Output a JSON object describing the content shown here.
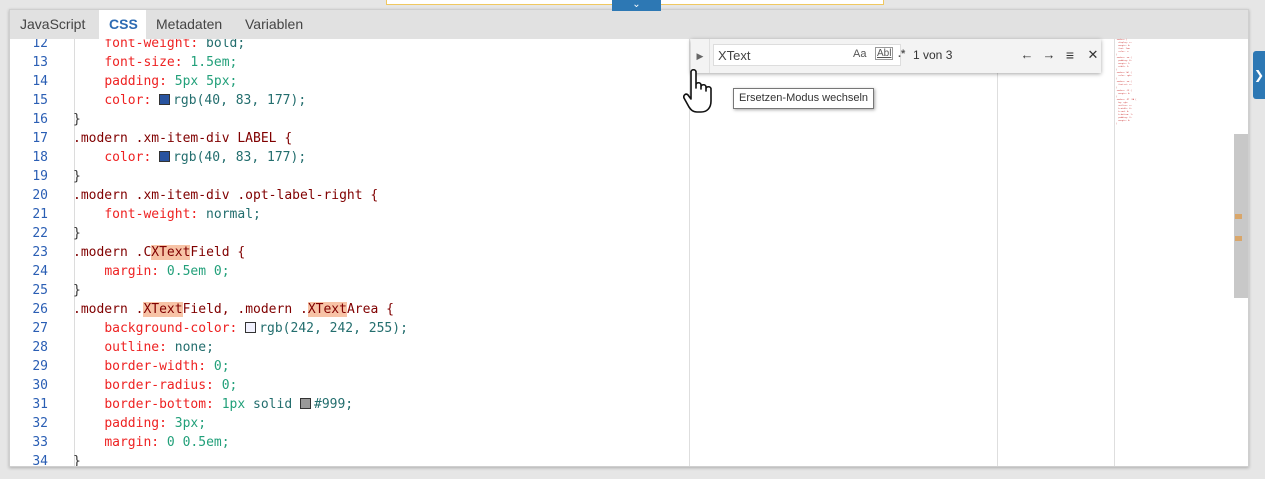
{
  "tabs": [
    {
      "label": "JavaScript",
      "active": false
    },
    {
      "label": "CSS",
      "active": true
    },
    {
      "label": "Metadaten",
      "active": false
    },
    {
      "label": "Variablen",
      "active": false
    }
  ],
  "find": {
    "query": "XText",
    "match_case": "Aa",
    "whole_word": "Abl",
    "regex": ".*",
    "count": "1 von 3"
  },
  "tooltip": "Ersetzen-Modus wechseln",
  "code_lines": [
    {
      "n": "12",
      "tokens": [
        {
          "t": "    ",
          "c": ""
        },
        {
          "t": "font-weight:",
          "c": "prop"
        },
        {
          "t": " bold;",
          "c": "val"
        }
      ]
    },
    {
      "n": "13",
      "tokens": [
        {
          "t": "    ",
          "c": ""
        },
        {
          "t": "font-size:",
          "c": "prop"
        },
        {
          "t": " 1.5em;",
          "c": "num"
        }
      ]
    },
    {
      "n": "14",
      "tokens": [
        {
          "t": "    ",
          "c": ""
        },
        {
          "t": "padding:",
          "c": "prop"
        },
        {
          "t": " 5px 5px;",
          "c": "num"
        }
      ]
    },
    {
      "n": "15",
      "tokens": [
        {
          "t": "    ",
          "c": ""
        },
        {
          "t": "color:",
          "c": "prop"
        },
        {
          "t": " ",
          "c": ""
        },
        {
          "sw": "#28539f"
        },
        {
          "t": "rgb(40, 83, 177);",
          "c": "val"
        }
      ]
    },
    {
      "n": "16",
      "tokens": [
        {
          "t": "}",
          "c": "pun"
        }
      ]
    },
    {
      "n": "17",
      "tokens": [
        {
          "t": ".modern .xm-item-div LABEL {",
          "c": "sel"
        }
      ]
    },
    {
      "n": "18",
      "tokens": [
        {
          "t": "    ",
          "c": ""
        },
        {
          "t": "color:",
          "c": "prop"
        },
        {
          "t": " ",
          "c": ""
        },
        {
          "sw": "#28539f"
        },
        {
          "t": "rgb(40, 83, 177);",
          "c": "val"
        }
      ]
    },
    {
      "n": "19",
      "tokens": [
        {
          "t": "}",
          "c": "pun"
        }
      ]
    },
    {
      "n": "20",
      "tokens": [
        {
          "t": ".modern .xm-item-div .opt-label-right {",
          "c": "sel"
        }
      ]
    },
    {
      "n": "21",
      "tokens": [
        {
          "t": "    ",
          "c": ""
        },
        {
          "t": "font-weight:",
          "c": "prop"
        },
        {
          "t": " normal;",
          "c": "val"
        }
      ]
    },
    {
      "n": "22",
      "tokens": [
        {
          "t": "}",
          "c": "pun"
        }
      ]
    },
    {
      "n": "23",
      "tokens": [
        {
          "t": ".modern .C",
          "c": "sel"
        },
        {
          "t": "XText",
          "c": "sel hl"
        },
        {
          "t": "Field {",
          "c": "sel"
        }
      ]
    },
    {
      "n": "24",
      "tokens": [
        {
          "t": "    ",
          "c": ""
        },
        {
          "t": "margin:",
          "c": "prop"
        },
        {
          "t": " 0.5em 0;",
          "c": "num"
        }
      ]
    },
    {
      "n": "25",
      "tokens": [
        {
          "t": "}",
          "c": "pun"
        }
      ]
    },
    {
      "n": "26",
      "tokens": [
        {
          "t": ".modern .",
          "c": "sel"
        },
        {
          "t": "XText",
          "c": "sel hl"
        },
        {
          "t": "Field, .modern .",
          "c": "sel"
        },
        {
          "t": "XText",
          "c": "sel hl"
        },
        {
          "t": "Area {",
          "c": "sel"
        }
      ]
    },
    {
      "n": "27",
      "tokens": [
        {
          "t": "    ",
          "c": ""
        },
        {
          "t": "background-color:",
          "c": "prop"
        },
        {
          "t": " ",
          "c": ""
        },
        {
          "sw": "#f2f2ff"
        },
        {
          "t": "rgb(242, 242, 255);",
          "c": "val"
        }
      ]
    },
    {
      "n": "28",
      "tokens": [
        {
          "t": "    ",
          "c": ""
        },
        {
          "t": "outline:",
          "c": "prop"
        },
        {
          "t": " none;",
          "c": "val"
        }
      ]
    },
    {
      "n": "29",
      "tokens": [
        {
          "t": "    ",
          "c": ""
        },
        {
          "t": "border-width:",
          "c": "prop"
        },
        {
          "t": " 0;",
          "c": "num"
        }
      ]
    },
    {
      "n": "30",
      "tokens": [
        {
          "t": "    ",
          "c": ""
        },
        {
          "t": "border-radius:",
          "c": "prop"
        },
        {
          "t": " 0;",
          "c": "num"
        }
      ]
    },
    {
      "n": "31",
      "tokens": [
        {
          "t": "    ",
          "c": ""
        },
        {
          "t": "border-bottom:",
          "c": "prop"
        },
        {
          "t": " 1px",
          "c": "num"
        },
        {
          "t": " solid ",
          "c": "val"
        },
        {
          "sw": "#999999"
        },
        {
          "t": "#999;",
          "c": "val"
        }
      ]
    },
    {
      "n": "32",
      "tokens": [
        {
          "t": "    ",
          "c": ""
        },
        {
          "t": "padding:",
          "c": "prop"
        },
        {
          "t": " 3px;",
          "c": "num"
        }
      ]
    },
    {
      "n": "33",
      "tokens": [
        {
          "t": "    ",
          "c": ""
        },
        {
          "t": "margin:",
          "c": "prop"
        },
        {
          "t": " 0 0.5em;",
          "c": "num"
        }
      ]
    },
    {
      "n": "34",
      "tokens": [
        {
          "t": "}",
          "c": "pun"
        }
      ]
    }
  ],
  "colors": {
    "accent": "#2d78b4",
    "tab_active": "#2d6bb3",
    "match_highlight": "#f7c3a6"
  },
  "icons": {
    "collapse": "chevron-down-icon",
    "find_toggle": "triangle-right-icon",
    "prev": "arrow-left-icon",
    "next": "arrow-right-icon",
    "in_selection": "lines-icon",
    "close": "close-icon",
    "side": "chevron-right-icon"
  }
}
